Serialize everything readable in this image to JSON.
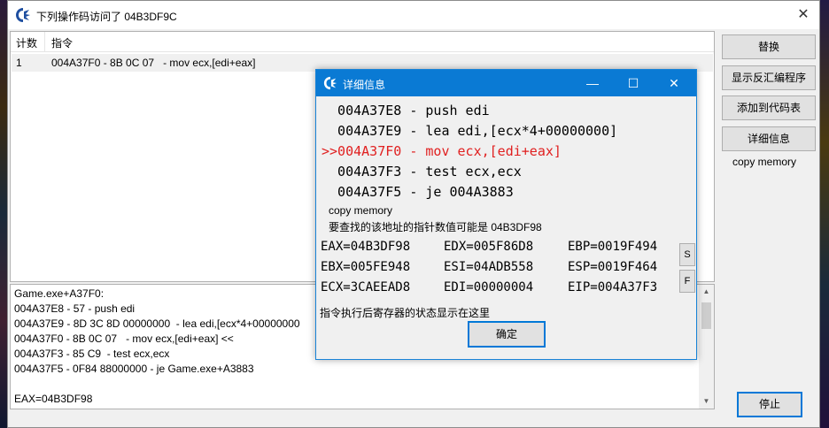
{
  "window": {
    "title": "下列操作码访问了 04B3DF9C"
  },
  "list": {
    "columns": [
      "计数",
      "指令"
    ],
    "rows": [
      {
        "count": "1",
        "instruction": "004A37F0 - 8B 0C 07   - mov ecx,[edi+eax]"
      }
    ]
  },
  "details_lines": [
    "Game.exe+A37F0:",
    "004A37E8 - 57 - push edi",
    "004A37E9 - 8D 3C 8D 00000000  - lea edi,[ecx*4+00000000",
    "004A37F0 - 8B 0C 07   - mov ecx,[edi+eax] <<",
    "004A37F3 - 85 C9  - test ecx,ecx",
    "004A37F5 - 0F84 88000000 - je Game.exe+A3883",
    "",
    "EAX=04B3DF98"
  ],
  "side": {
    "replace": "替换",
    "show_disasm": "显示反汇编程序",
    "add_codelist": "添加到代码表",
    "details": "详细信息",
    "copy_memory": "copy memory",
    "stop": "停止"
  },
  "dialog": {
    "title": "详细信息",
    "asm_lines": [
      {
        "text": "  004A37E8 - push edi",
        "highlight": false
      },
      {
        "text": "  004A37E9 - lea edi,[ecx*4+00000000]",
        "highlight": false
      },
      {
        "text": ">>004A37F0 - mov ecx,[edi+eax]",
        "highlight": true
      },
      {
        "text": "  004A37F3 - test ecx,ecx",
        "highlight": false
      },
      {
        "text": "  004A37F5 - je 004A3883",
        "highlight": false
      }
    ],
    "copy_memory": "copy memory",
    "pointer_note": "要查找的该地址的指针数值可能是 04B3DF98",
    "registers": [
      [
        "EAX=04B3DF98",
        "EDX=005F86D8",
        "EBP=0019F494"
      ],
      [
        "EBX=005FE948",
        "ESI=04ADB558",
        "ESP=0019F464"
      ],
      [
        "ECX=3CAEEAD8",
        "EDI=00000004",
        "EIP=004A37F3"
      ]
    ],
    "s_label": "S",
    "f_label": "F",
    "status": "指令执行后寄存器的状态显示在这里",
    "ok": "确定"
  },
  "colors": {
    "title_blue": "#0a7ad4",
    "highlight_red": "#e02020",
    "accent": "#0078d7"
  }
}
